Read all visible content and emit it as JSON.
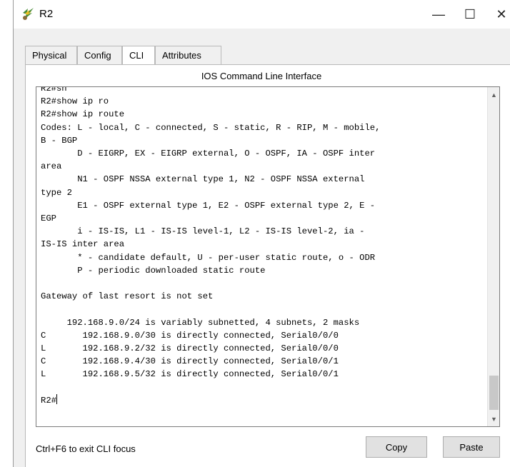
{
  "window": {
    "title": "R2",
    "app_icon": "router-icon",
    "controls": {
      "minimize": "—",
      "maximize": "☐",
      "close": "✕"
    }
  },
  "tabs": [
    {
      "label": "Physical",
      "active": false
    },
    {
      "label": "Config",
      "active": false
    },
    {
      "label": "CLI",
      "active": true
    },
    {
      "label": "Attributes",
      "active": false
    }
  ],
  "panel": {
    "title": "IOS Command Line Interface"
  },
  "terminal": {
    "lines": [
      "R2#sh",
      "R2#show ip ro",
      "R2#show ip route",
      "Codes: L - local, C - connected, S - static, R - RIP, M - mobile,",
      "B - BGP",
      "       D - EIGRP, EX - EIGRP external, O - OSPF, IA - OSPF inter",
      "area",
      "       N1 - OSPF NSSA external type 1, N2 - OSPF NSSA external",
      "type 2",
      "       E1 - OSPF external type 1, E2 - OSPF external type 2, E -",
      "EGP",
      "       i - IS-IS, L1 - IS-IS level-1, L2 - IS-IS level-2, ia -",
      "IS-IS inter area",
      "       * - candidate default, U - per-user static route, o - ODR",
      "       P - periodic downloaded static route",
      "",
      "Gateway of last resort is not set",
      "",
      "     192.168.9.0/24 is variably subnetted, 4 subnets, 2 masks",
      "C       192.168.9.0/30 is directly connected, Serial0/0/0",
      "L       192.168.9.2/32 is directly connected, Serial0/0/0",
      "C       192.168.9.4/30 is directly connected, Serial0/0/1",
      "L       192.168.9.5/32 is directly connected, Serial0/0/1",
      ""
    ],
    "prompt": "R2#"
  },
  "footer": {
    "hint": "Ctrl+F6 to exit CLI focus",
    "copy_label": "Copy",
    "paste_label": "Paste"
  }
}
